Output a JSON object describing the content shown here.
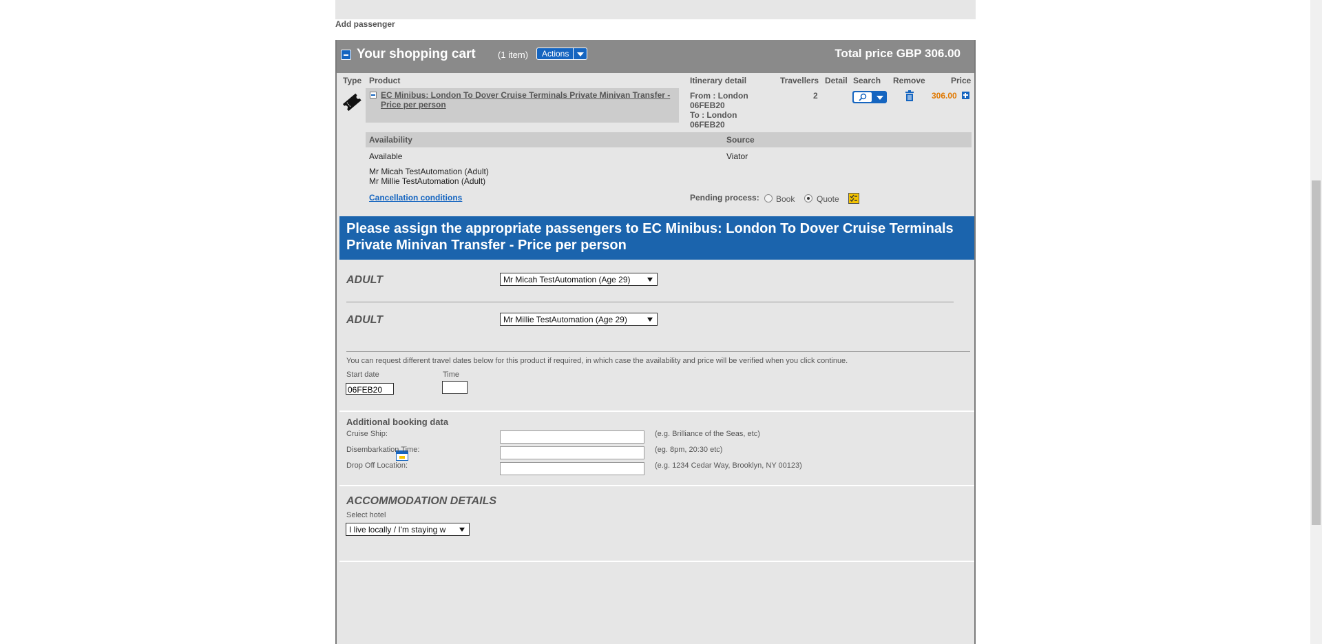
{
  "top": {
    "add_passenger": "Add passenger"
  },
  "cart": {
    "title": "Your shopping cart",
    "count": "(1 item)",
    "actions_label": "Actions",
    "total": "Total price GBP 306.00",
    "headers": {
      "type": "Type",
      "product": "Product",
      "itinerary": "Itinerary detail",
      "travellers": "Travellers",
      "detail": "Detail",
      "search": "Search",
      "remove": "Remove",
      "price": "Price"
    },
    "item": {
      "product_name": "EC Minibus: London To Dover Cruise Terminals Private Minivan Transfer - Price per person",
      "from_line": "From : London",
      "from_date": "06FEB20",
      "to_line": "To : London",
      "to_date": "06FEB20",
      "travellers": "2",
      "price": "306.00",
      "availability_header": "Availability",
      "source_header": "Source",
      "availability": "Available",
      "source": "Viator",
      "passenger1": "Mr Micah TestAutomation (Adult)",
      "passenger2": "Mr Millie TestAutomation (Adult)",
      "cancellation": "Cancellation conditions",
      "pending_label": "Pending process:",
      "pending_book": "Book",
      "pending_quote": "Quote"
    }
  },
  "assign": {
    "banner": "Please assign the appropriate passengers to EC Minibus: London To Dover Cruise Terminals Private Minivan Transfer - Price per person",
    "rows": [
      {
        "type": "ADULT",
        "selected": "Mr Micah TestAutomation (Age 29)"
      },
      {
        "type": "ADULT",
        "selected": "Mr Millie TestAutomation (Age 29)"
      }
    ],
    "dates_note": "You can request different travel dates below for this product if required, in which case the availability and price will be verified when you click continue.",
    "start_date_label": "Start date",
    "time_label": "Time",
    "start_date_value": "06FEB20"
  },
  "booking_data": {
    "title": "Additional booking data",
    "fields": [
      {
        "label": "Cruise Ship:",
        "hint": "(e.g. Brilliance of the Seas, etc)"
      },
      {
        "label": "Disembarkation Time:",
        "hint": "(eg. 8pm, 20:30 etc)"
      },
      {
        "label": "Drop Off Location:",
        "hint": "(e.g. 1234 Cedar Way, Brooklyn, NY 00123)"
      }
    ]
  },
  "accommodation": {
    "title": "ACCOMMODATION DETAILS",
    "select_label": "Select hotel",
    "selected": "I live locally / I'm staying w"
  },
  "colors": {
    "accent": "#1565c0",
    "banner": "#1b64ad",
    "header": "#8a8a8a",
    "price": "#e07800"
  }
}
